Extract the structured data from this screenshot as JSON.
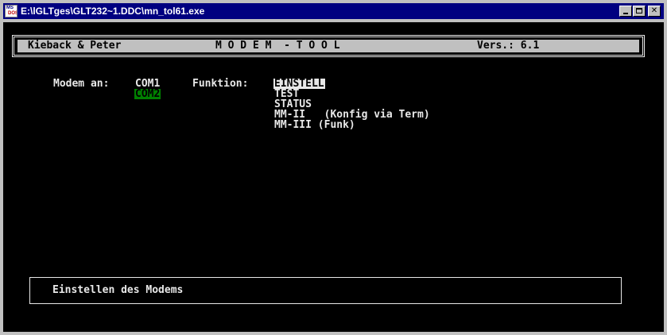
{
  "window": {
    "title": "E:\\lGLTges\\GLT232~1.DDC\\mn_tol61.exe",
    "icon": "ms-dos-icon",
    "buttons": [
      "minimize",
      "maximize",
      "close"
    ]
  },
  "header": {
    "vendor": "Kieback & Peter",
    "app_title": "M O D E M  - T O O L",
    "version": "Vers.: 6.1"
  },
  "modem": {
    "label": "Modem an:",
    "ports": [
      {
        "label": "COM1",
        "selected": false
      },
      {
        "label": "COM2",
        "selected": true
      }
    ]
  },
  "funktion": {
    "label": "Funktion:",
    "items": [
      {
        "label": "EINSTELL",
        "selected": true
      },
      {
        "label": "TEST",
        "selected": false
      },
      {
        "label": "STATUS",
        "selected": false
      },
      {
        "label": "MM-II   (Konfig via Term)",
        "selected": false
      },
      {
        "label": "MM-III (Funk)",
        "selected": false
      }
    ]
  },
  "status": {
    "text": "Einstellen des Modems"
  },
  "colors": {
    "titlebar": "#000080",
    "console_bg": "#000000",
    "text": "#e8e8e8",
    "port_highlight": "#008000"
  }
}
